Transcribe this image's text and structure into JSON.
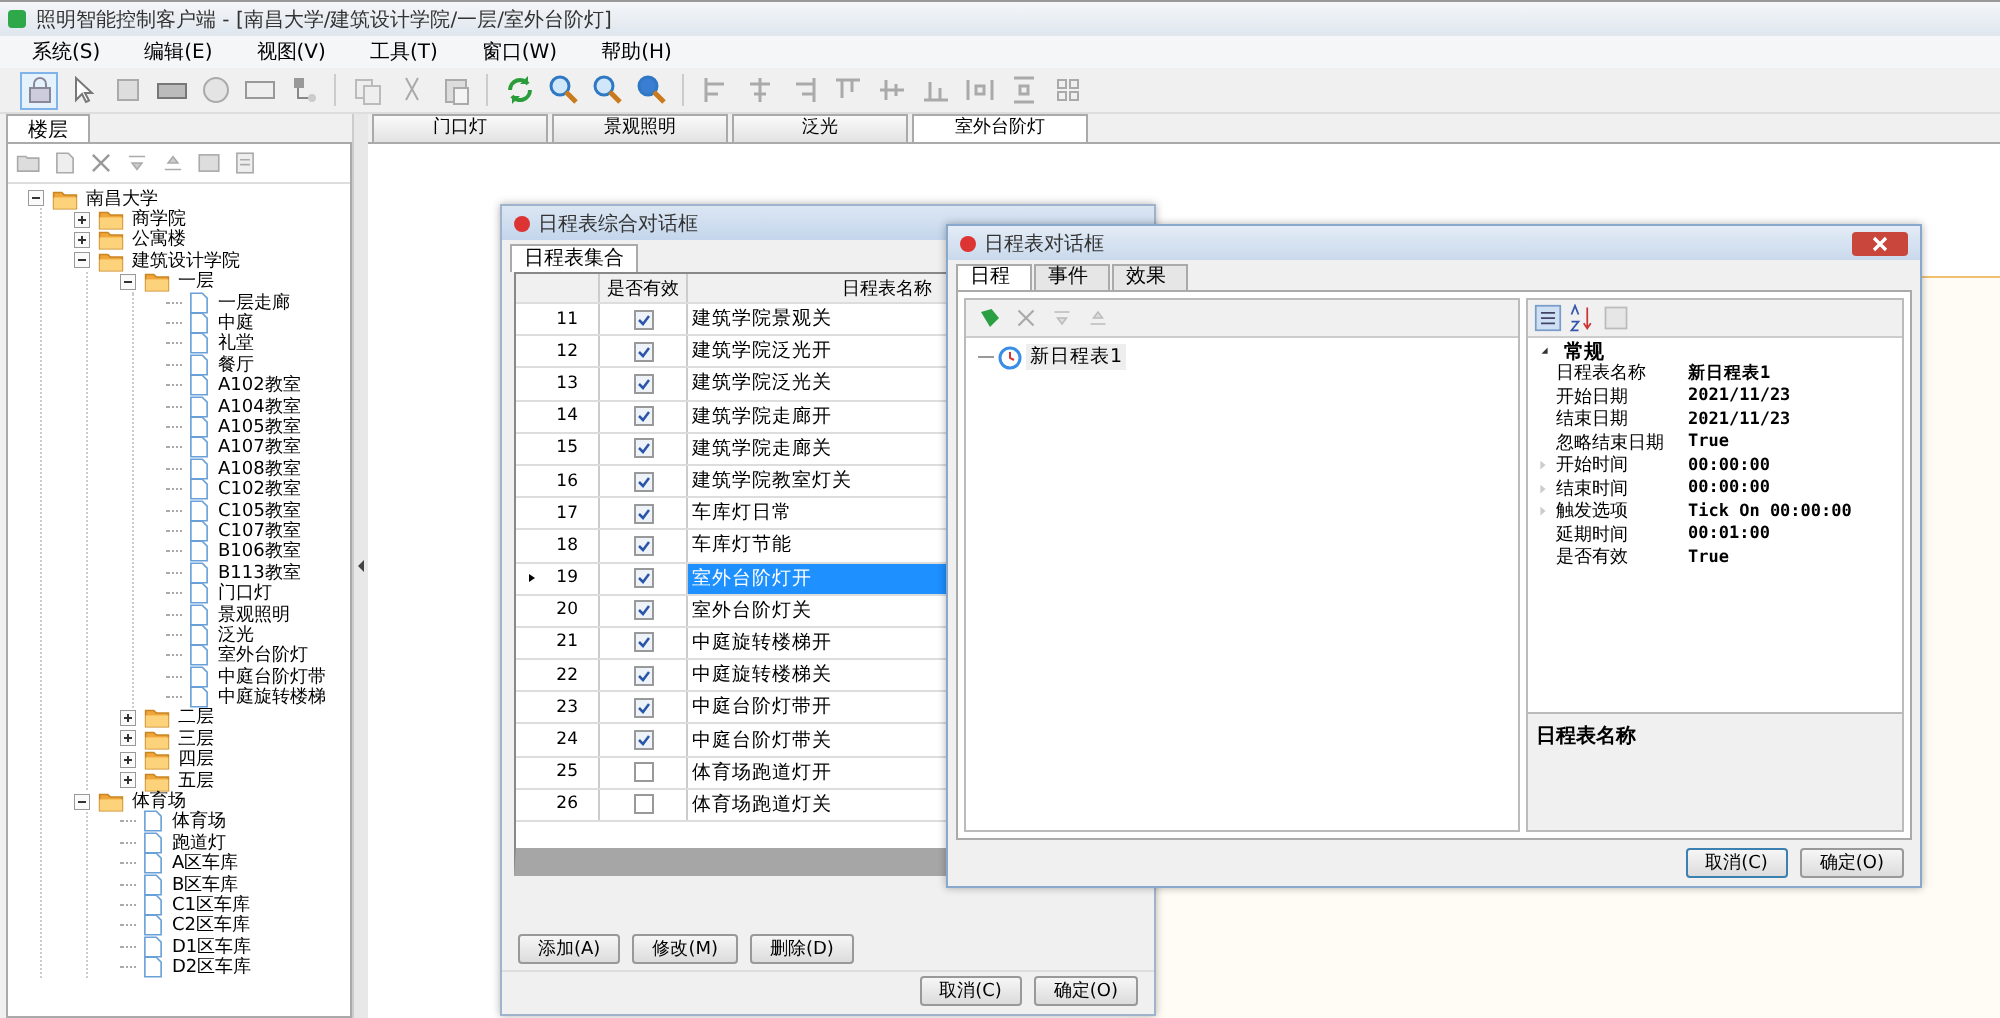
{
  "window": {
    "title": "照明智能控制客户端 - [南昌大学/建筑设计学院/一层/室外台阶灯]"
  },
  "menu": [
    "系统(S)",
    "编辑(E)",
    "视图(V)",
    "工具(T)",
    "窗口(W)",
    "帮助(H)"
  ],
  "sidebar": {
    "tab": "楼层",
    "tree": [
      {
        "label": "南昌大学",
        "kind": "folder",
        "expanded": true,
        "children": [
          {
            "label": "商学院",
            "kind": "folder",
            "expanded": false
          },
          {
            "label": "公寓楼",
            "kind": "folder",
            "expanded": false
          },
          {
            "label": "建筑设计学院",
            "kind": "folder",
            "expanded": true,
            "children": [
              {
                "label": "一层",
                "kind": "folder",
                "expanded": true,
                "children": [
                  {
                    "label": "一层走廊",
                    "kind": "item"
                  },
                  {
                    "label": "中庭",
                    "kind": "item"
                  },
                  {
                    "label": "礼堂",
                    "kind": "item"
                  },
                  {
                    "label": "餐厅",
                    "kind": "item"
                  },
                  {
                    "label": "A102教室",
                    "kind": "item"
                  },
                  {
                    "label": "A104教室",
                    "kind": "item"
                  },
                  {
                    "label": "A105教室",
                    "kind": "item"
                  },
                  {
                    "label": "A107教室",
                    "kind": "item"
                  },
                  {
                    "label": "A108教室",
                    "kind": "item"
                  },
                  {
                    "label": "C102教室",
                    "kind": "item"
                  },
                  {
                    "label": "C105教室",
                    "kind": "item"
                  },
                  {
                    "label": "C107教室",
                    "kind": "item"
                  },
                  {
                    "label": "B106教室",
                    "kind": "item"
                  },
                  {
                    "label": "B113教室",
                    "kind": "item"
                  },
                  {
                    "label": "门口灯",
                    "kind": "item"
                  },
                  {
                    "label": "景观照明",
                    "kind": "item"
                  },
                  {
                    "label": "泛光",
                    "kind": "item"
                  },
                  {
                    "label": "室外台阶灯",
                    "kind": "item"
                  },
                  {
                    "label": "中庭台阶灯带",
                    "kind": "item"
                  },
                  {
                    "label": "中庭旋转楼梯",
                    "kind": "item"
                  }
                ]
              },
              {
                "label": "二层",
                "kind": "folder",
                "expanded": false
              },
              {
                "label": "三层",
                "kind": "folder",
                "expanded": false
              },
              {
                "label": "四层",
                "kind": "folder",
                "expanded": false
              },
              {
                "label": "五层",
                "kind": "folder",
                "expanded": false
              }
            ]
          },
          {
            "label": "体育场",
            "kind": "folder",
            "expanded": true,
            "children": [
              {
                "label": "体育场",
                "kind": "item"
              },
              {
                "label": "跑道灯",
                "kind": "item"
              },
              {
                "label": "A区车库",
                "kind": "item"
              },
              {
                "label": "B区车库",
                "kind": "item"
              },
              {
                "label": "C1区车库",
                "kind": "item"
              },
              {
                "label": "C2区车库",
                "kind": "item"
              },
              {
                "label": "D1区车库",
                "kind": "item"
              },
              {
                "label": "D2区车库",
                "kind": "item"
              }
            ]
          }
        ]
      }
    ]
  },
  "doc_tabs": [
    {
      "label": "门口灯",
      "selected": false
    },
    {
      "label": "景观照明",
      "selected": false
    },
    {
      "label": "泛光",
      "selected": false
    },
    {
      "label": "室外台阶灯",
      "selected": true
    }
  ],
  "schedule_list_dialog": {
    "title": "日程表综合对话框",
    "tab": "日程表集合",
    "columns": [
      "是否有效",
      "日程表名称"
    ],
    "rows": [
      {
        "index": "11",
        "valid": true,
        "name": "建筑学院景观关",
        "selected": false
      },
      {
        "index": "12",
        "valid": true,
        "name": "建筑学院泛光开",
        "selected": false
      },
      {
        "index": "13",
        "valid": true,
        "name": "建筑学院泛光关",
        "selected": false
      },
      {
        "index": "14",
        "valid": true,
        "name": "建筑学院走廊开",
        "selected": false
      },
      {
        "index": "15",
        "valid": true,
        "name": "建筑学院走廊关",
        "selected": false
      },
      {
        "index": "16",
        "valid": true,
        "name": "建筑学院教室灯关",
        "selected": false
      },
      {
        "index": "17",
        "valid": true,
        "name": "车库灯日常",
        "selected": false
      },
      {
        "index": "18",
        "valid": true,
        "name": "车库灯节能",
        "selected": false
      },
      {
        "index": "19",
        "valid": true,
        "name": "室外台阶灯开",
        "selected": true
      },
      {
        "index": "20",
        "valid": true,
        "name": "室外台阶灯关",
        "selected": false
      },
      {
        "index": "21",
        "valid": true,
        "name": "中庭旋转楼梯开",
        "selected": false
      },
      {
        "index": "22",
        "valid": true,
        "name": "中庭旋转楼梯关",
        "selected": false
      },
      {
        "index": "23",
        "valid": true,
        "name": "中庭台阶灯带开",
        "selected": false
      },
      {
        "index": "24",
        "valid": true,
        "name": "中庭台阶灯带关",
        "selected": false
      },
      {
        "index": "25",
        "valid": false,
        "name": "体育场跑道灯开",
        "selected": false
      },
      {
        "index": "26",
        "valid": false,
        "name": "体育场跑道灯关",
        "selected": false
      }
    ],
    "buttons": [
      "添加(A)",
      "修改(M)",
      "删除(D)"
    ],
    "footer_buttons": [
      "取消(C)",
      "确定(O)"
    ]
  },
  "schedule_dialog": {
    "title": "日程表对话框",
    "tabs": [
      {
        "label": "日程",
        "selected": true
      },
      {
        "label": "事件",
        "selected": false
      },
      {
        "label": "效果",
        "selected": false
      }
    ],
    "tree_item": "新日程表1",
    "category": "常规",
    "properties": [
      {
        "name": "日程表名称",
        "value": "新日程表1",
        "expandable": false
      },
      {
        "name": "开始日期",
        "value": "2021/11/23",
        "expandable": false
      },
      {
        "name": "结束日期",
        "value": "2021/11/23",
        "expandable": false
      },
      {
        "name": "忽略结束日期",
        "value": "True",
        "expandable": false
      },
      {
        "name": "开始时间",
        "value": "00:00:00",
        "expandable": true
      },
      {
        "name": "结束时间",
        "value": "00:00:00",
        "expandable": true
      },
      {
        "name": "触发选项",
        "value": "Tick On 00:00:00",
        "expandable": true
      },
      {
        "name": "延期时间",
        "value": "00:01:00",
        "expandable": false
      },
      {
        "name": "是否有效",
        "value": "True",
        "expandable": false
      }
    ],
    "description": "日程表名称",
    "buttons": [
      "取消(C)",
      "确定(O)"
    ]
  }
}
